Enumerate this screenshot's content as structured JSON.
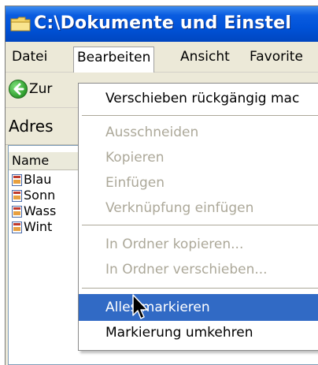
{
  "window": {
    "title": "C:\\Dokumente und Einstel",
    "title_icon": "folder-icon"
  },
  "menubar": {
    "items": [
      {
        "label": "Datei"
      },
      {
        "label": "Bearbeiten"
      },
      {
        "label": "Ansicht"
      },
      {
        "label": "Favorite"
      }
    ]
  },
  "toolbar": {
    "back_label": "Zur",
    "back_icon": "back-arrow-icon"
  },
  "addressbar": {
    "label": "Adres"
  },
  "filelist": {
    "column_header": "Name",
    "files": [
      {
        "name": "Blau"
      },
      {
        "name": "Sonn"
      },
      {
        "name": "Wass"
      },
      {
        "name": "Wint"
      }
    ]
  },
  "edit_menu": {
    "undo": "Verschieben rückgängig mac",
    "cut": "Ausschneiden",
    "copy": "Kopieren",
    "paste": "Einfügen",
    "paste_shortcut": "Verknüpfung einfügen",
    "copy_to_folder": "In Ordner kopieren...",
    "move_to_folder": "In Ordner verschieben...",
    "select_all": "Alles markieren",
    "invert_selection": "Markierung umkehren"
  },
  "colors": {
    "titlebar": "#0052d8",
    "menu_highlight": "#316ac5",
    "disabled_text": "#aca899"
  }
}
